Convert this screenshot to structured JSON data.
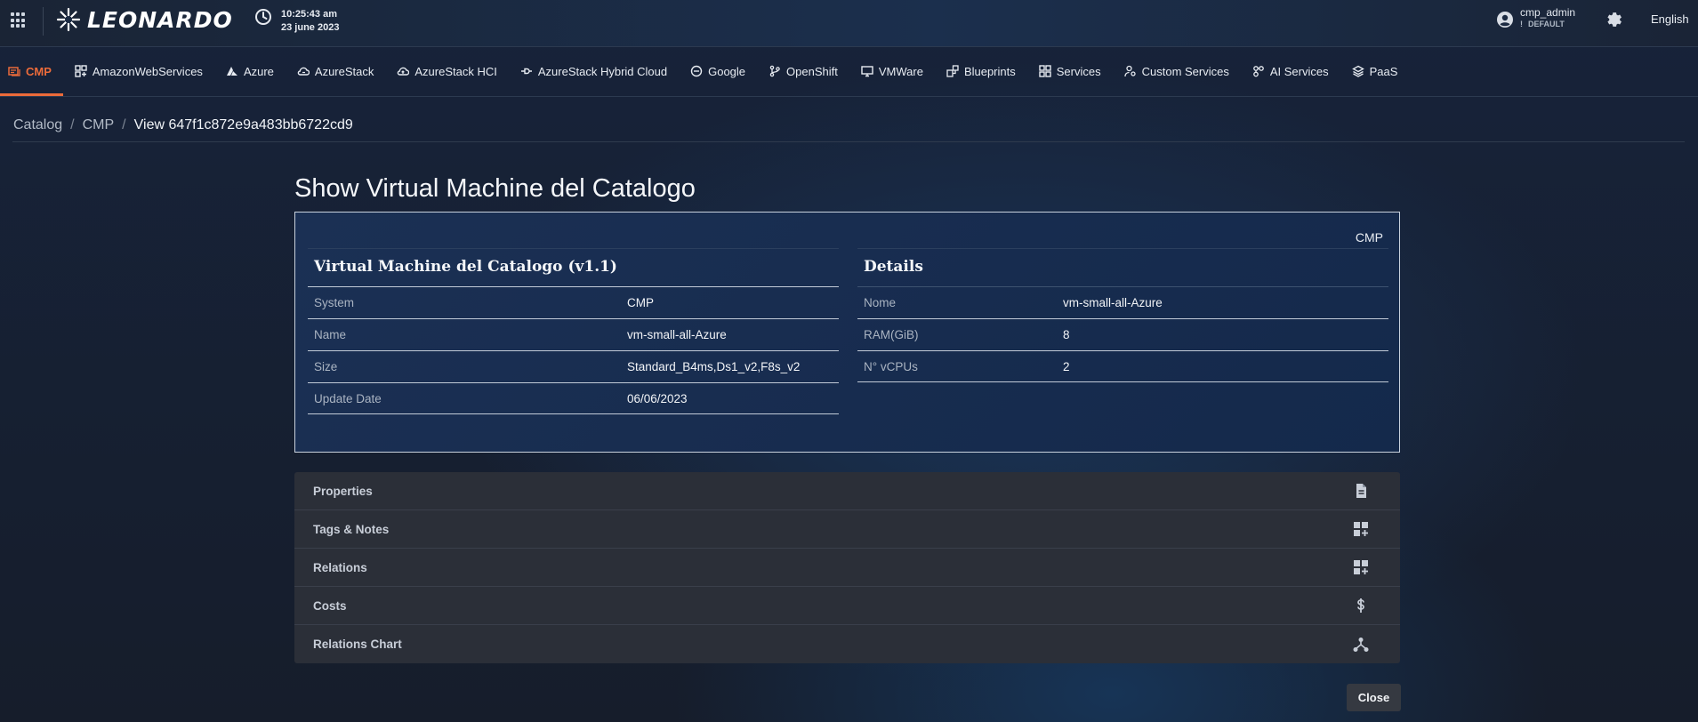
{
  "header": {
    "logo_text": "LEONARDO",
    "time": "10:25:43 am",
    "date": "23 june 2023",
    "user_name": "cmp_admin",
    "user_role_marker": "!",
    "user_role": "DEFAULT",
    "language": "English"
  },
  "nav": {
    "tabs": [
      {
        "label": "CMP",
        "icon": "cmp-icon",
        "active": true
      },
      {
        "label": "AmazonWebServices",
        "icon": "grid-plus-icon"
      },
      {
        "label": "Azure",
        "icon": "azure-icon"
      },
      {
        "label": "AzureStack",
        "icon": "cloud-sync-icon"
      },
      {
        "label": "AzureStack HCI",
        "icon": "cloud-upload-icon"
      },
      {
        "label": "AzureStack Hybrid Cloud",
        "icon": "plug-icon"
      },
      {
        "label": "Google",
        "icon": "google-icon"
      },
      {
        "label": "OpenShift",
        "icon": "branch-icon"
      },
      {
        "label": "VMWare",
        "icon": "monitor-icon"
      },
      {
        "label": "Blueprints",
        "icon": "blueprint-icon"
      },
      {
        "label": "Services",
        "icon": "grid-icon"
      },
      {
        "label": "Custom Services",
        "icon": "user-gear-icon"
      },
      {
        "label": "AI Services",
        "icon": "ai-icon"
      },
      {
        "label": "PaaS",
        "icon": "layers-icon"
      }
    ]
  },
  "breadcrumb": {
    "items": [
      "Catalog",
      "CMP"
    ],
    "separator": "/",
    "current": "View 647f1c872e9a483bb6722cd9"
  },
  "main": {
    "title": "Show Virtual Machine del Catalogo",
    "card_tag": "CMP",
    "left_panel": {
      "title": "Virtual Machine del Catalogo (v1.1)",
      "rows": [
        {
          "label": "System",
          "value": "CMP"
        },
        {
          "label": "Name",
          "value": "vm-small-all-Azure"
        },
        {
          "label": "Size",
          "value": "Standard_B4ms,Ds1_v2,F8s_v2"
        },
        {
          "label": "Update Date",
          "value": "06/06/2023"
        }
      ]
    },
    "right_panel": {
      "title": "Details",
      "rows": [
        {
          "label": "Nome",
          "value": "vm-small-all-Azure"
        },
        {
          "label": "RAM(GiB)",
          "value": "8"
        },
        {
          "label": "N° vCPUs",
          "value": "2"
        }
      ]
    },
    "accordion": [
      {
        "label": "Properties",
        "icon": "document-icon"
      },
      {
        "label": "Tags & Notes",
        "icon": "dashboard-add-icon"
      },
      {
        "label": "Relations",
        "icon": "dashboard-add-icon"
      },
      {
        "label": "Costs",
        "icon": "dollar-icon"
      },
      {
        "label": "Relations Chart",
        "icon": "hierarchy-icon"
      }
    ],
    "close_label": "Close"
  },
  "colors": {
    "accent": "#ec6b3a",
    "card_bg": "#1b3054",
    "accordion_bg": "#2b2f38"
  }
}
